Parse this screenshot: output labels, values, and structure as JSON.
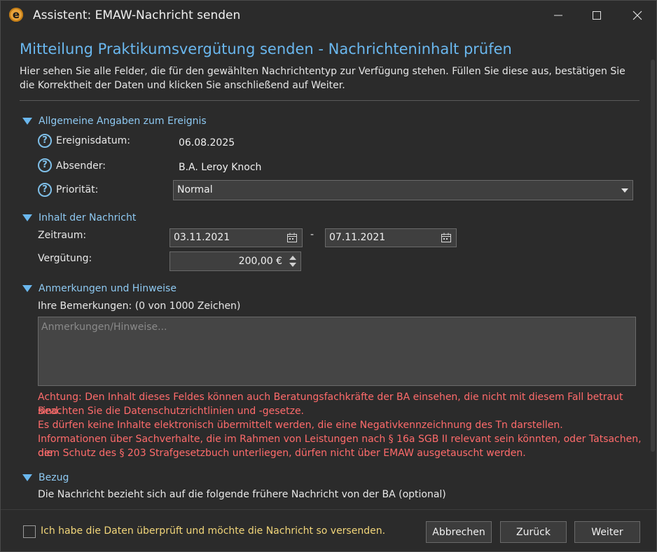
{
  "window": {
    "title": "Assistent: EMAW-Nachricht senden",
    "app_icon_letter": "e"
  },
  "header": {
    "headline": "Mitteilung Praktikumsvergütung senden - Nachrichteninhalt prüfen",
    "intro": "Hier sehen Sie alle Felder, die für den gewählten Nachrichtentyp zur Verfügung stehen. Füllen Sie diese aus, bestätigen Sie die Korrektheit der Daten und klicken Sie anschließend auf Weiter."
  },
  "general": {
    "title": "Allgemeine Angaben zum Ereignis",
    "date_label": "Ereignisdatum:",
    "date_value": "06.08.2025",
    "sender_label": "Absender:",
    "sender_value": "B.A. Leroy Knoch",
    "priority_label": "Priorität:",
    "priority_value": "Normal"
  },
  "content": {
    "title": "Inhalt der Nachricht",
    "period_label": "Zeitraum:",
    "period_from": "03.11.2021",
    "period_separator": "-",
    "period_to": "07.11.2021",
    "pay_label": "Vergütung:",
    "pay_value": "200,00 €"
  },
  "remarks": {
    "title": "Anmerkungen und Hinweise",
    "label": "Ihre Bemerkungen: (0 von 1000 Zeichen)",
    "placeholder": "Anmerkungen/Hinweise...",
    "warning_lines": [
      "Achtung: Den Inhalt dieses Feldes können auch Beratungsfachkräfte der BA einsehen, die nicht mit diesem Fall betraut sind.",
      "Beachten Sie die Datenschutzrichtlinien und -gesetze.",
      "Es dürfen keine Inhalte elektronisch übermittelt werden, die eine Negativkennzeichnung des Tn darstellen.",
      "Informationen über Sachverhalte, die im Rahmen von Leistungen nach § 16a SGB II relevant sein könnten, oder Tatsachen, die",
      "dem Schutz des § 203 Strafgesetzbuch unterliegen, dürfen nicht über EMAW ausgetauscht werden."
    ]
  },
  "reference": {
    "title": "Bezug",
    "text": "Die Nachricht bezieht sich auf die folgende frühere Nachricht von der BA (optional)"
  },
  "footer": {
    "confirm_label": "Ich habe die Daten überprüft und möchte die Nachricht so versenden.",
    "cancel_label": "Abbrechen",
    "back_label": "Zurück",
    "next_label": "Weiter"
  },
  "colors": {
    "accent": "#6ab7ee",
    "warning": "#ff6b6b",
    "confirm_text": "#f2d67a",
    "background": "#2b2b2b"
  }
}
